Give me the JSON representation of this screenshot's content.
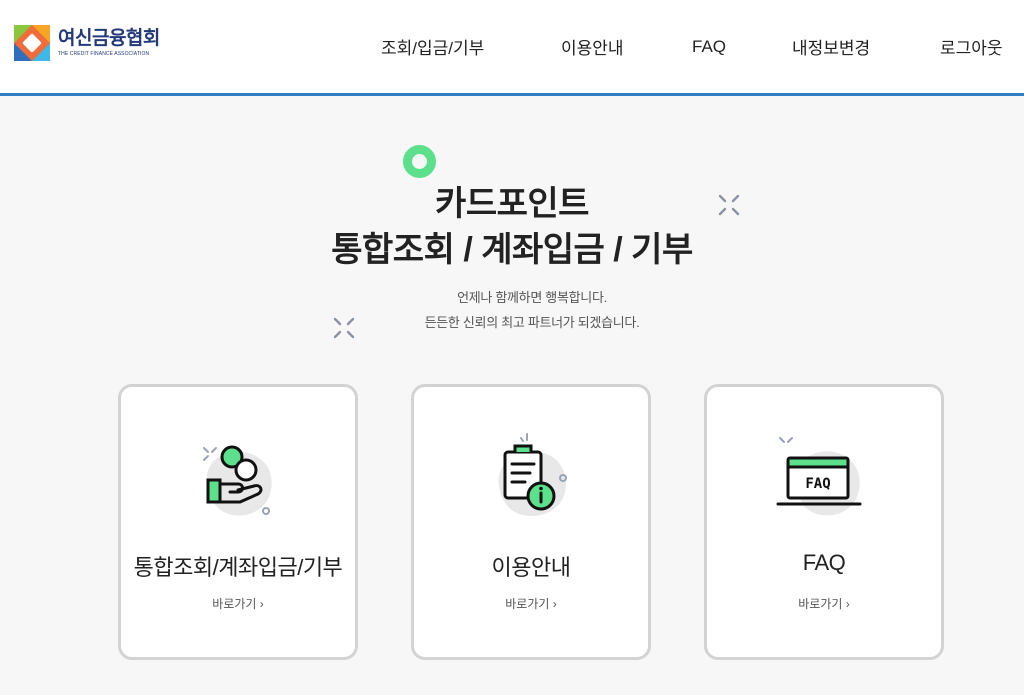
{
  "header": {
    "logo": {
      "name": "여신금융협회",
      "sub": "THE CREDIT FINANCE ASSOCIATION"
    },
    "nav": [
      {
        "label": "조회/입금/기부"
      },
      {
        "label": "이용안내"
      },
      {
        "label": "FAQ"
      },
      {
        "label": "내정보변경"
      },
      {
        "label": "로그아웃"
      }
    ]
  },
  "hero": {
    "title_line1": "카드포인트",
    "title_line2": "통합조회 / 계좌입금 / 기부",
    "subtitle_line1": "언제나 함께하면 행복합니다.",
    "subtitle_line2": "든든한 신뢰의 최고 파트너가 되겠습니다."
  },
  "cards": [
    {
      "title": "통합조회/계좌입금/기부",
      "link": "바로가기 ›",
      "icon": "coin-hand-icon"
    },
    {
      "title": "이용안내",
      "link": "바로가기 ›",
      "icon": "clipboard-info-icon"
    },
    {
      "title": "FAQ",
      "link": "바로가기 ›",
      "icon": "faq-laptop-icon",
      "icon_text": "FAQ"
    }
  ],
  "colors": {
    "accent_green": "#5ce08b",
    "header_line": "#2f7fc4",
    "logo_text": "#233a7a"
  }
}
